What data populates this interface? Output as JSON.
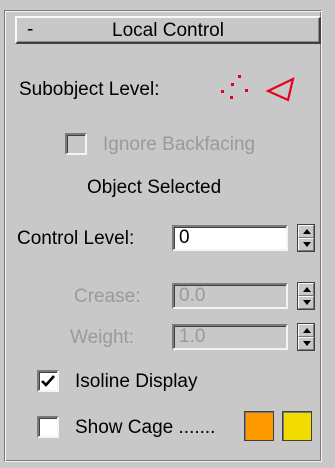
{
  "rollout": {
    "collapse_symbol": "-",
    "title": "Local Control"
  },
  "subobject": {
    "label": "Subobject Level:",
    "icons": [
      "vertex-icon",
      "polygon-icon"
    ],
    "icon_color": "#e8001e"
  },
  "ignore_backfacing": {
    "label": "Ignore Backfacing",
    "checked": false,
    "enabled": false
  },
  "selection_status": "Object Selected",
  "control_level": {
    "label": "Control Level:",
    "value": "0"
  },
  "crease": {
    "label": "Crease:",
    "value": "0.0",
    "enabled": false
  },
  "weight": {
    "label": "Weight:",
    "value": "1.0",
    "enabled": false
  },
  "isoline_display": {
    "label": "Isoline Display",
    "checked": true
  },
  "show_cage": {
    "label": "Show Cage .......",
    "checked": false,
    "colors": [
      "#ff9900",
      "#f2dc00"
    ]
  }
}
